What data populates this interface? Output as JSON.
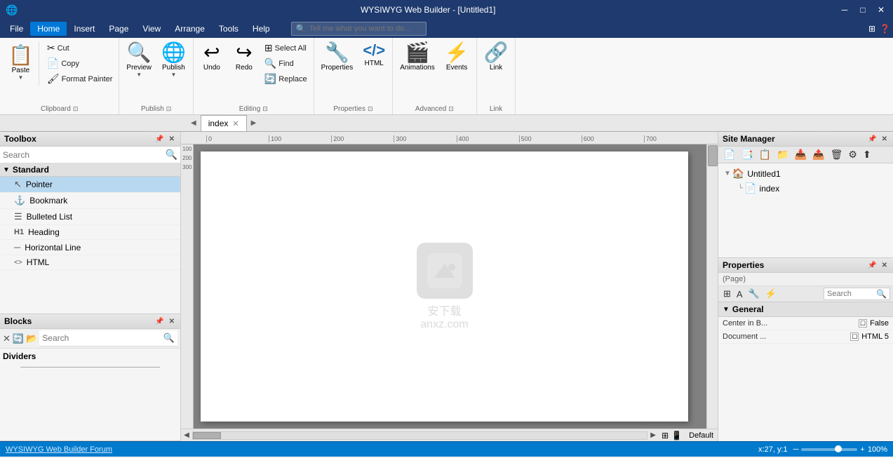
{
  "titlebar": {
    "title": "WYSIWYG Web Builder - [Untitled1]",
    "min": "─",
    "restore": "□",
    "close": "✕"
  },
  "menubar": {
    "items": [
      "File",
      "Home",
      "Insert",
      "Page",
      "View",
      "Arrange",
      "Tools",
      "Help"
    ],
    "active": "Home",
    "search_placeholder": "Tell me what you want to do...",
    "icons": [
      "⊞",
      "⊟"
    ]
  },
  "ribbon": {
    "groups": [
      {
        "id": "clipboard",
        "label": "Clipboard",
        "paste_label": "Paste",
        "items_right": [
          "Cut",
          "Copy",
          "Format Painter"
        ]
      },
      {
        "id": "publish",
        "label": "Publish",
        "items": [
          "Preview",
          "Publish"
        ]
      },
      {
        "id": "editing",
        "label": "Editing",
        "items": [
          "Select All",
          "Find",
          "Replace"
        ],
        "undo": "Undo",
        "redo": "Redo"
      },
      {
        "id": "properties",
        "label": "Properties",
        "items": [
          "Properties",
          "HTML"
        ]
      },
      {
        "id": "advanced",
        "label": "Advanced",
        "items": [
          "Animations",
          "Events"
        ]
      },
      {
        "id": "link",
        "label": "Link",
        "items": [
          "Link"
        ]
      }
    ]
  },
  "tabs": {
    "items": [
      "index"
    ],
    "active": "index"
  },
  "toolbox": {
    "title": "Toolbox",
    "search_placeholder": "Search",
    "categories": [
      {
        "name": "Standard",
        "expanded": true,
        "items": [
          {
            "name": "Pointer",
            "icon": "↖"
          },
          {
            "name": "Bookmark",
            "icon": "⚓"
          },
          {
            "name": "Bulleted List",
            "icon": "☰"
          },
          {
            "name": "Heading",
            "icon": "H1"
          },
          {
            "name": "Horizontal Line",
            "icon": "─"
          },
          {
            "name": "HTML",
            "icon": "<>"
          }
        ]
      }
    ]
  },
  "blocks": {
    "title": "Blocks",
    "search_placeholder": "Search",
    "categories": [
      {
        "name": "Dividers",
        "items": []
      }
    ]
  },
  "canvas": {
    "ruler_marks": [
      "0",
      "100",
      "200",
      "300",
      "400",
      "500",
      "600",
      "700"
    ],
    "watermark_text": "安下载\nanxz.com",
    "page_tab": "Default"
  },
  "site_manager": {
    "title": "Site Manager",
    "tree": [
      {
        "label": "Untitled1",
        "icon": "🏠",
        "level": 0
      },
      {
        "label": "index",
        "icon": "📄",
        "level": 1
      }
    ]
  },
  "properties": {
    "title": "Properties",
    "label": "(Page)",
    "search_placeholder": "Search",
    "tabs": [
      "⊞",
      "A↕",
      "🔧",
      "⚡"
    ],
    "general_section": {
      "name": "General",
      "rows": [
        {
          "name": "Center in B...",
          "value": "False",
          "checkbox": true
        },
        {
          "name": "Document ...",
          "value": "HTML 5",
          "checkbox": true
        }
      ]
    }
  },
  "statusbar": {
    "link_text": "WYSIWYG Web Builder Forum",
    "coords": "x:27, y:1",
    "zoom": "100%",
    "zoom_value": 100
  }
}
